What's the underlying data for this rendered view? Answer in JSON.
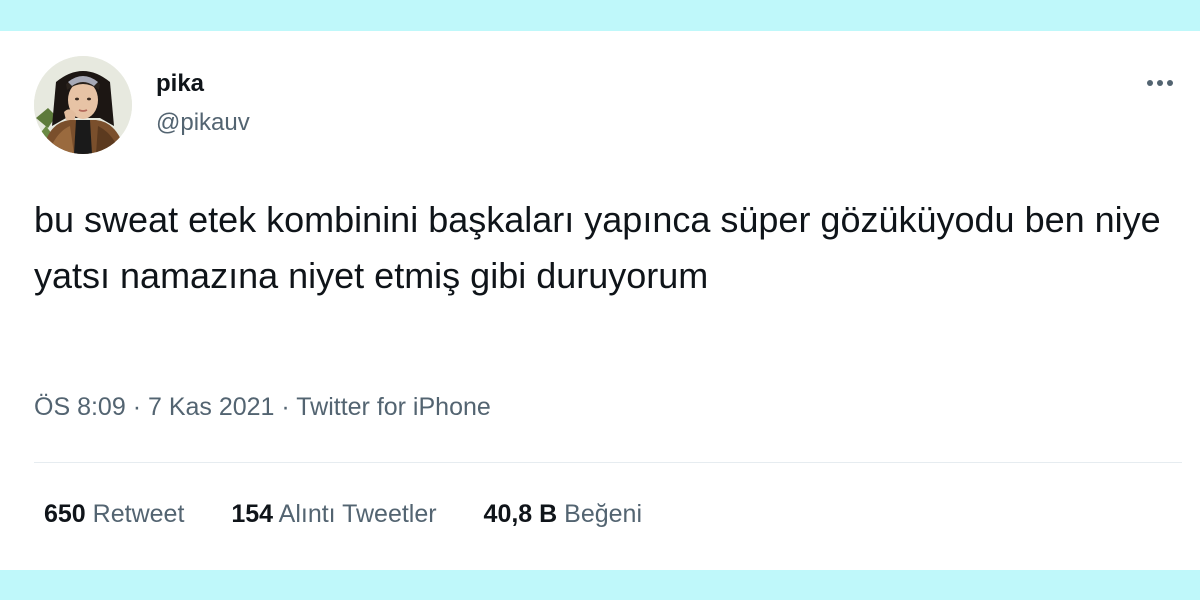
{
  "colors": {
    "page_background": "#bff8fa",
    "card_background": "#ffffff",
    "primary_text": "#0f1419",
    "secondary_text": "#536471"
  },
  "user": {
    "name": "pika",
    "handle": "@pikauv",
    "avatar_icon": "profile-photo"
  },
  "tweet": {
    "text": "bu sweat etek kombinini başkaları yapınca süper gözüküyodu ben niye yatsı namazına niyet etmiş gibi duruyorum",
    "time": "ÖS 8:09",
    "date": "7 Kas 2021",
    "source": "Twitter for iPhone",
    "separator": "·"
  },
  "stats": {
    "retweets": {
      "count": "650",
      "label": "Retweet"
    },
    "quotes": {
      "count": "154",
      "label": "Alıntı Tweetler"
    },
    "likes": {
      "count": "40,8 B",
      "label": "Beğeni"
    }
  },
  "icons": {
    "more": "more-horizontal-icon"
  }
}
